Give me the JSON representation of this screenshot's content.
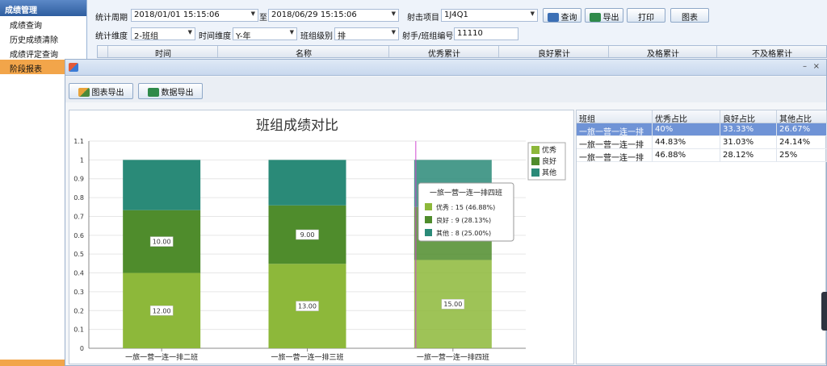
{
  "nav": {
    "header": "成绩管理",
    "items": [
      "成绩查询",
      "历史成绩清除",
      "成绩评定查询",
      "阶段报表"
    ],
    "active_index": 3
  },
  "filters": {
    "period_label": "统计周期",
    "period_start": "2018/01/01 15:15:06",
    "to_label": "至",
    "period_end": "2018/06/29 15:15:06",
    "project_label": "射击项目",
    "project_value": "1J4Q1",
    "dim_label": "统计维度",
    "dim_value": "2-班组",
    "time_dim_label": "时间维度",
    "time_dim_value": "Y-年",
    "group_level_label": "班组级别",
    "group_level_value": "排",
    "shooter_label": "射手/班组编号",
    "shooter_value": "11110",
    "query_btn": "查询",
    "export_btn": "导出",
    "print_btn": "打印",
    "chart_btn": "图表"
  },
  "grid": {
    "columns": [
      "时间",
      "名称",
      "优秀累计",
      "良好累计",
      "及格累计",
      "不及格累计"
    ]
  },
  "popup": {
    "minimize": "–",
    "close": "×",
    "chart_export_btn": "图表导出",
    "data_export_btn": "数据导出"
  },
  "colors": {
    "excellent": "#8db83a",
    "good": "#4f8c2c",
    "other": "#2a8a78",
    "selected_row": "#6f93d6",
    "nav_active": "#f2a54a"
  },
  "chart_data": {
    "type": "bar",
    "stacked": true,
    "title": "班组成绩对比",
    "categories": [
      "一旅一营一连一排二班",
      "一旅一营一连一排三班",
      "一旅一营一连一排四班"
    ],
    "series": [
      {
        "name": "优秀",
        "values": [
          0.4,
          0.4483,
          0.4688
        ],
        "labels": [
          "12.00",
          "13.00",
          "15.00"
        ]
      },
      {
        "name": "良好",
        "values": [
          0.3333,
          0.3103,
          0.2812
        ],
        "labels": [
          "10.00",
          "9.00",
          ""
        ]
      },
      {
        "name": "其他",
        "values": [
          0.2667,
          0.2414,
          0.25
        ],
        "labels": [
          "",
          "",
          ""
        ]
      }
    ],
    "y_ticks": [
      "0",
      "0.1",
      "0.2",
      "0.3",
      "0.4",
      "0.5",
      "0.6",
      "0.7",
      "0.8",
      "0.9",
      "1",
      "1.1"
    ],
    "ylim": [
      0,
      1.1
    ],
    "grid": true,
    "legend": "right",
    "tooltip": {
      "title": "一旅一营一连一排四班",
      "lines": [
        "优秀 : 15 (46.88%)",
        "良好 : 9 (28.13%)",
        "其他 : 8 (25.00%)"
      ]
    }
  },
  "table": {
    "columns": [
      "班组",
      "优秀占比",
      "良好占比",
      "其他占比"
    ],
    "rows": [
      [
        "一旅一营一连一排",
        "40%",
        "33.33%",
        "26.67%"
      ],
      [
        "一旅一营一连一排",
        "44.83%",
        "31.03%",
        "24.14%"
      ],
      [
        "一旅一营一连一排",
        "46.88%",
        "28.12%",
        "25%"
      ]
    ],
    "selected_row": 0
  }
}
